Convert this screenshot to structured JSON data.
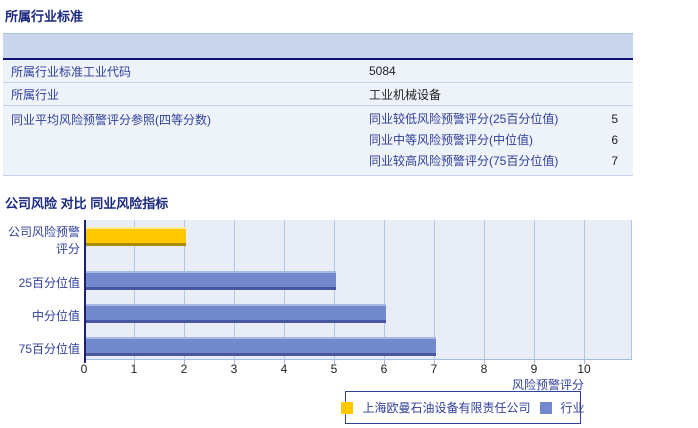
{
  "section1": {
    "title": "所属行业标准",
    "table": {
      "rows": [
        {
          "label": "所属行业标准工业代码",
          "value": "5084"
        },
        {
          "label": "所属行业",
          "value": "工业机械设备"
        }
      ],
      "group_row": {
        "label": "同业平均风险预警评分参照(四等分数)",
        "items": [
          {
            "label": "同业较低风险预警评分(25百分位值)",
            "value": "5"
          },
          {
            "label": "同业中等风险预警评分(中位值)",
            "value": "6"
          },
          {
            "label": "同业较高风险预警评分(75百分位值)",
            "value": "7"
          }
        ]
      }
    }
  },
  "section2": {
    "title": "公司风险 对比 同业风险指标"
  },
  "chart_data": {
    "type": "bar",
    "orientation": "horizontal",
    "title": "公司风险 对比 同业风险指标",
    "categories": [
      "公司风险预警评分",
      "25百分位值",
      "中分位值",
      "75百分位值"
    ],
    "series": [
      {
        "name": "上海欧曼石油设备有限责任公司",
        "color": "#ffc800",
        "values": [
          2,
          null,
          null,
          null
        ]
      },
      {
        "name": "行业",
        "color": "#7289cb",
        "values": [
          null,
          5,
          6,
          7
        ]
      }
    ],
    "xlabel": "风险预警评分",
    "xlim": [
      0,
      10
    ],
    "x_ticks": [
      0,
      1,
      2,
      3,
      4,
      5,
      6,
      7,
      8,
      9,
      10
    ],
    "grid": true,
    "legend_position": "bottom"
  },
  "colors": {
    "accent_title": "#1b2a80",
    "label_text": "#31409a",
    "table_header_bg": "#c9d6ee",
    "table_header_border": "#0d1470",
    "row_bg": "#eef2f9",
    "plot_bg": "#e9edf6",
    "gridline": "#b3c6e8",
    "company_bar": "#ffc800",
    "industry_bar": "#7289cb"
  }
}
